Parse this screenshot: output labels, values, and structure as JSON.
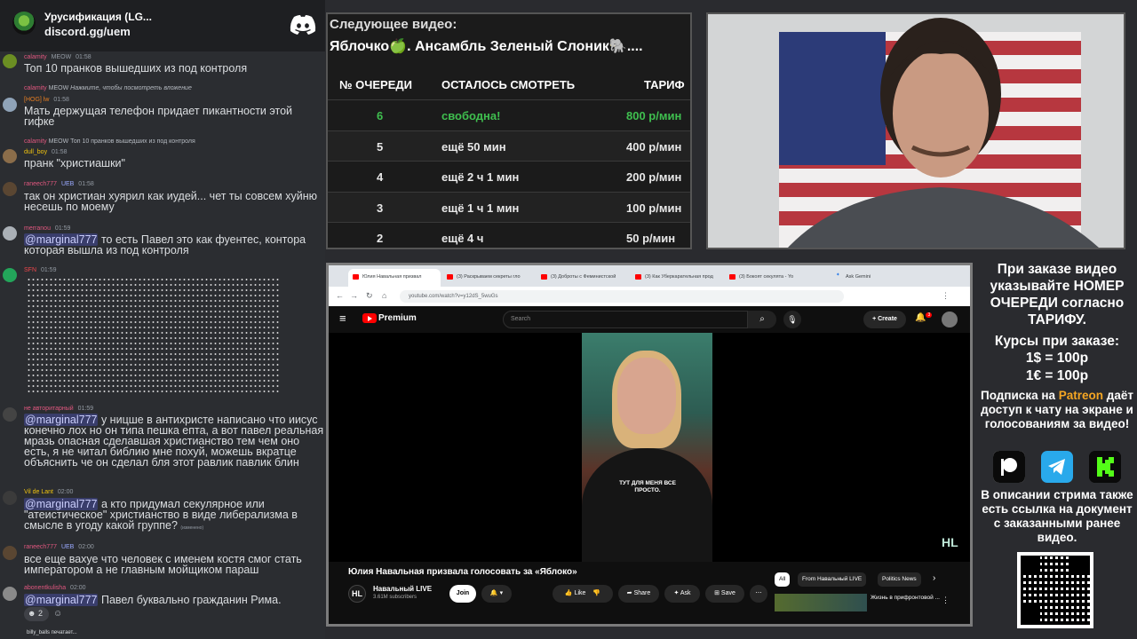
{
  "discord": {
    "server_name": "Урусификация (LG...",
    "invite": "discord.gg/uem",
    "messages": [
      {
        "user": "calamity",
        "badge": "MEOW",
        "time": "01:58",
        "text": "Топ 10 пранков вышедших из под контроля"
      },
      {
        "reply_user": "calamity",
        "reply_badge": "MEOW",
        "reply_text": "Нажмите, чтобы посмотреть вложение",
        "user": "[HOG] lw",
        "time": "01:58",
        "text": "Мать держущая телефон придает пикантности этой гифке"
      },
      {
        "reply_user": "calamity",
        "reply_badge": "MEOW",
        "reply_text": "Топ 10 пранков вышедших из под контроля",
        "user": "dull_boy",
        "time": "01:58",
        "text": "пранк \"христиашки\""
      },
      {
        "user": "raneech777",
        "badge": "UEB",
        "time": "01:58",
        "text": "так он христиан хуярил как иудей... чет ты совсем хуйню несешь по моему"
      },
      {
        "user": "merranou",
        "time": "01:59",
        "mention": "@marginal777",
        "text": " то есть Павел это как фуентес, контора которая вышла из под контроля"
      },
      {
        "user": "SFN",
        "time": "01:59",
        "text": ""
      },
      {
        "user": "не авторитарный",
        "time": "01:59",
        "mention": "@marginal777",
        "text": " у ницше в антихристе написано что иисус конечно лох но он типа пешка епта, а вот павел реальная мразь опасная сделавшая христианство тем чем оно есть, я не читал библию мне похуй, можешь вкратце объяснить че он сделал бля этот равлик павлик блин"
      },
      {
        "user": "Vil de Lant",
        "time": "02:00",
        "mention": "@marginal777",
        "text": " а кто придумал секулярное или \"атеистическое\" христианство в виде либерализма в смысле в угоду какой группе?",
        "edited": "(изменено)"
      },
      {
        "user": "raneech777",
        "badge": "UEB",
        "time": "02:00",
        "text": "все еще вахуе что человек с именем костя смог стать императором а не главным мойщиком параш"
      },
      {
        "user": "abonentkulisha",
        "time": "02:00",
        "mention": "@marginal777",
        "text": " Павел буквально гражданин Рима."
      }
    ],
    "reaction_count": "2",
    "typing": "billy_balls печатает..."
  },
  "queue": {
    "next_label": "Следующее видео:",
    "next_title": "Яблочко🍏. Ансамбль Зеленый Слоник🐘....",
    "headers": [
      "№ ОЧЕРЕДИ",
      "ОСТАЛОСЬ СМОТРЕТЬ",
      "ТАРИФ"
    ],
    "rows": [
      {
        "num": "6",
        "left": "свободна!",
        "price": "800 р/мин"
      },
      {
        "num": "5",
        "left": "ещё 50 мин",
        "price": "400 р/мин"
      },
      {
        "num": "4",
        "left": "ещё 2 ч 1 мин",
        "price": "200 р/мин"
      },
      {
        "num": "3",
        "left": "ещё 1 ч 1 мин",
        "price": "100 р/мин"
      },
      {
        "num": "2",
        "left": "ещё 4 ч",
        "price": "50 р/мин"
      }
    ]
  },
  "browser": {
    "tabs": [
      "Юлия Навальная призвал",
      "(3) Раскрываем секреты гло",
      "(3) Доброты с Феминистской",
      "(3) Как Уберкарательная прод",
      "(3) Бокоят секулята - Yo",
      "Ask Gemini"
    ],
    "url": "youtube.com/watch?v=y12dS_5wuGs",
    "yt_logo": "Premium",
    "search_placeholder": "Search",
    "create_label": "Create",
    "notif_count": "3",
    "video_caption": "ТУТ ДЛЯ МЕНЯ ВСЕ ПРОСТО.",
    "watermark": "HL",
    "video_title": "Юлия Навальная призвала голосовать за «Яблоко»",
    "channel_name": "Навальный LIVE",
    "subscribers": "3.61M subscribers",
    "join": "Join",
    "like": "Like",
    "share": "Share",
    "ask": "Ask",
    "save": "Save",
    "chips": [
      "All",
      "From Навальный LIVE",
      "Politics News"
    ],
    "rec_title": "Жизнь в прифронтовой ..."
  },
  "info": {
    "order_text": "При заказе видео указывайте НОМЕР ОЧЕРЕДИ согласно ТАРИФУ.",
    "rates_label": "Курсы при заказе:",
    "rate_usd": "1$ = 100р",
    "rate_eur": "1€ = 100р",
    "sub_pre": "Подписка на ",
    "patreon": "Patreon",
    "sub_post": " даёт доступ к чату на экране и голосованиям за видео!",
    "desc_text": "В описании стрима также есть ссылка на документ с заказанными ранее видео."
  },
  "colors": {
    "free": "#3fbf4f",
    "patreon": "#f5a623",
    "youtube_red": "#ff0000",
    "discord_bg": "#2b2d31"
  }
}
